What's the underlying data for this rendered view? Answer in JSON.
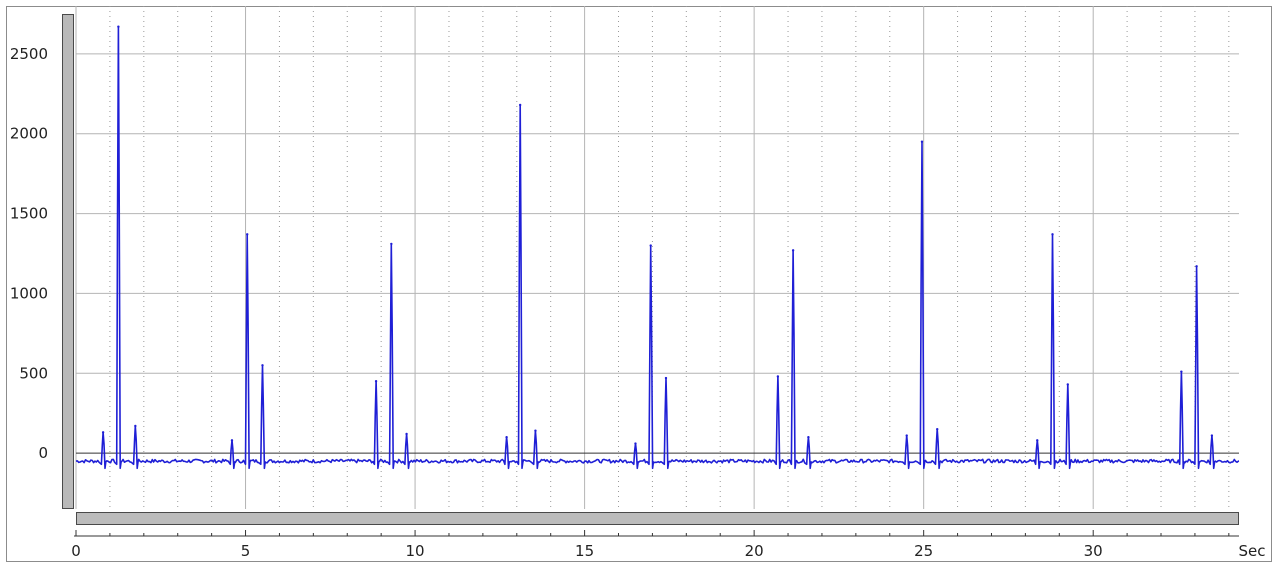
{
  "chart_data": {
    "type": "line",
    "title": "",
    "xlabel": "",
    "x_unit": "Sec",
    "ylabel": "",
    "xlim": [
      0,
      34.3
    ],
    "ylim": [
      -350,
      2800
    ],
    "x_ticks": [
      0,
      5,
      10,
      15,
      20,
      25,
      30
    ],
    "x_minor_step": 1,
    "y_ticks": [
      0,
      500,
      1000,
      1500,
      2000,
      2500
    ],
    "grid": true,
    "legend": "none",
    "baseline": -50,
    "series": [
      {
        "color": "#1f1fd6",
        "peaks": [
          {
            "x": 0.8,
            "y": 130
          },
          {
            "x": 1.25,
            "y": 2670
          },
          {
            "x": 1.75,
            "y": 170
          },
          {
            "x": 4.6,
            "y": 80
          },
          {
            "x": 5.05,
            "y": 1370
          },
          {
            "x": 5.5,
            "y": 550
          },
          {
            "x": 8.85,
            "y": 450
          },
          {
            "x": 9.3,
            "y": 1310
          },
          {
            "x": 9.75,
            "y": 120
          },
          {
            "x": 12.7,
            "y": 100
          },
          {
            "x": 13.1,
            "y": 2180
          },
          {
            "x": 13.55,
            "y": 140
          },
          {
            "x": 16.5,
            "y": 60
          },
          {
            "x": 16.95,
            "y": 1300
          },
          {
            "x": 17.4,
            "y": 470
          },
          {
            "x": 20.7,
            "y": 480
          },
          {
            "x": 21.15,
            "y": 1270
          },
          {
            "x": 21.6,
            "y": 100
          },
          {
            "x": 24.5,
            "y": 110
          },
          {
            "x": 24.95,
            "y": 1950
          },
          {
            "x": 25.4,
            "y": 150
          },
          {
            "x": 28.35,
            "y": 80
          },
          {
            "x": 28.8,
            "y": 1370
          },
          {
            "x": 29.25,
            "y": 430
          },
          {
            "x": 32.6,
            "y": 510
          },
          {
            "x": 33.05,
            "y": 1170
          },
          {
            "x": 33.5,
            "y": 110
          }
        ]
      }
    ]
  }
}
